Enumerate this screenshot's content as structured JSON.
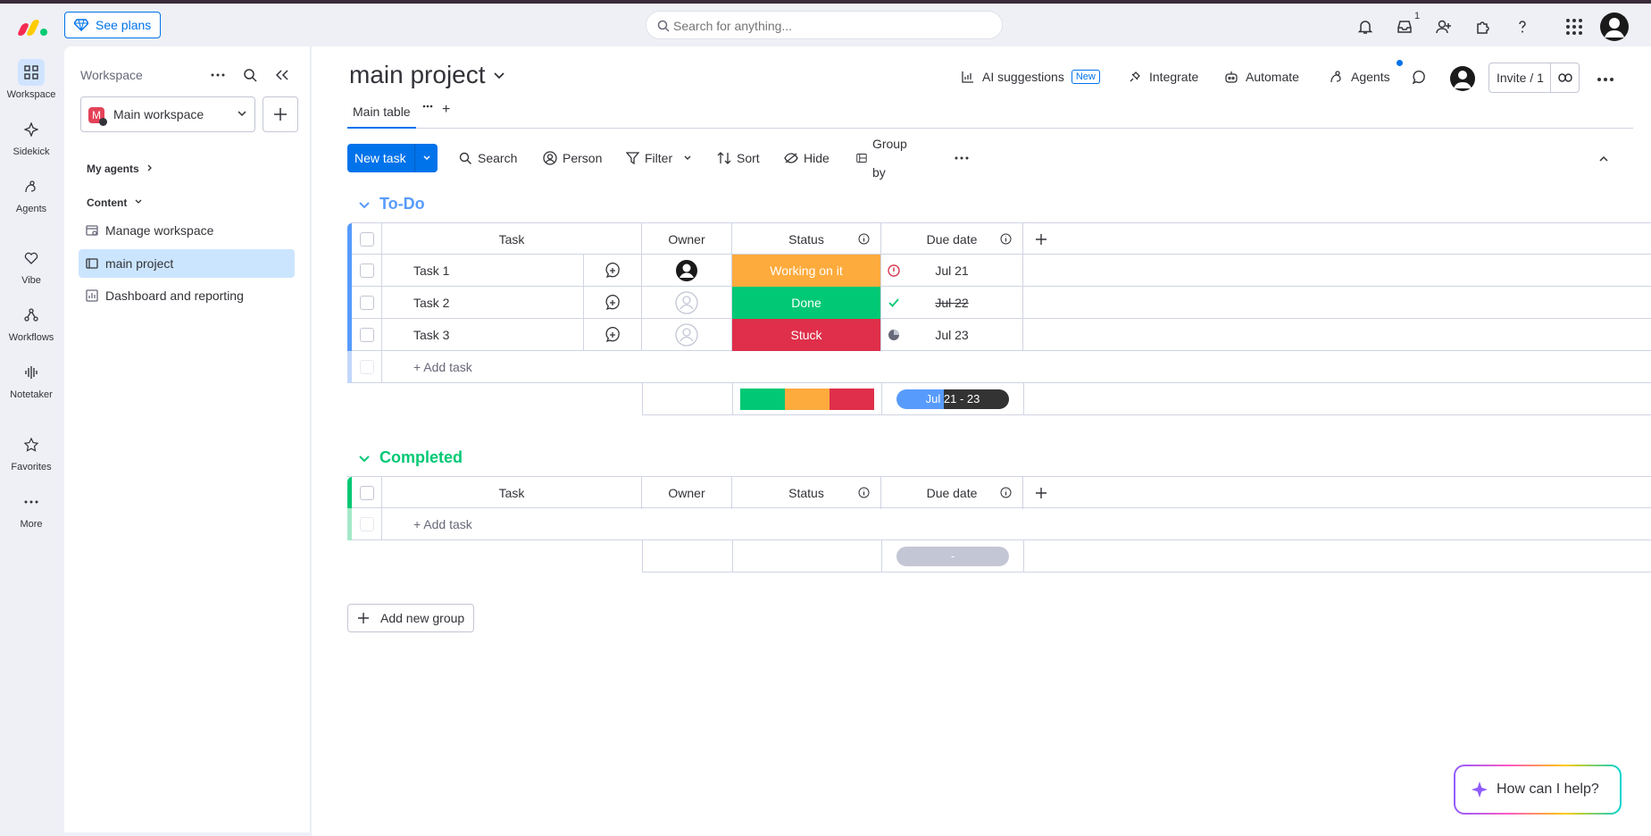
{
  "topbar": {
    "see_plans": "See plans",
    "search_placeholder": "Search for anything...",
    "inbox_badge": "1"
  },
  "leftnav": [
    {
      "label": "Workspace",
      "icon": "grid-icon"
    },
    {
      "label": "Sidekick",
      "icon": "sparkle-icon"
    },
    {
      "label": "Agents",
      "icon": "agent-icon"
    },
    {
      "label": "Vibe",
      "icon": "heart-icon"
    },
    {
      "label": "Workflows",
      "icon": "workflow-icon"
    },
    {
      "label": "Notetaker",
      "icon": "waveform-icon"
    },
    {
      "label": "Favorites",
      "icon": "star-icon"
    },
    {
      "label": "More",
      "icon": "more-icon"
    }
  ],
  "sidebar": {
    "title": "Workspace",
    "workspace_initial": "M",
    "workspace_name": "Main workspace",
    "my_agents": "My agents",
    "content": "Content",
    "items": [
      {
        "label": "Manage workspace",
        "icon": "manage-icon"
      },
      {
        "label": "main project",
        "icon": "board-icon"
      },
      {
        "label": "Dashboard and reporting",
        "icon": "dashboard-icon"
      }
    ]
  },
  "header": {
    "title": "main project",
    "ai_suggestions": "AI suggestions",
    "new_tag": "New",
    "integrate": "Integrate",
    "automate": "Automate",
    "agents": "Agents",
    "invite": "Invite / 1"
  },
  "tabs": {
    "main_table": "Main table",
    "add": "+"
  },
  "toolbar": {
    "new_task": "New task",
    "search": "Search",
    "person": "Person",
    "filter": "Filter",
    "sort": "Sort",
    "hide": "Hide",
    "group_by": "Group by"
  },
  "columns": {
    "task": "Task",
    "owner": "Owner",
    "status": "Status",
    "due_date": "Due date"
  },
  "groups": {
    "todo": {
      "title": "To-Do",
      "color": "#579bfc",
      "rows": [
        {
          "task": "Task 1",
          "status": "Working on it",
          "status_color": "#fdab3d",
          "due": "Jul 21",
          "due_state": "overdue"
        },
        {
          "task": "Task 2",
          "status": "Done",
          "status_color": "#00c875",
          "due": "Jul 22",
          "due_state": "done"
        },
        {
          "task": "Task 3",
          "status": "Stuck",
          "status_color": "#df2f4a",
          "due": "Jul 23",
          "due_state": "pending"
        }
      ],
      "add_task": "+ Add task",
      "summary_range": "Jul 21 - 23"
    },
    "completed": {
      "title": "Completed",
      "color": "#00c875",
      "add_task": "+ Add task",
      "summary_range": "-"
    }
  },
  "add_group": "Add new group",
  "help": "How can I help?"
}
